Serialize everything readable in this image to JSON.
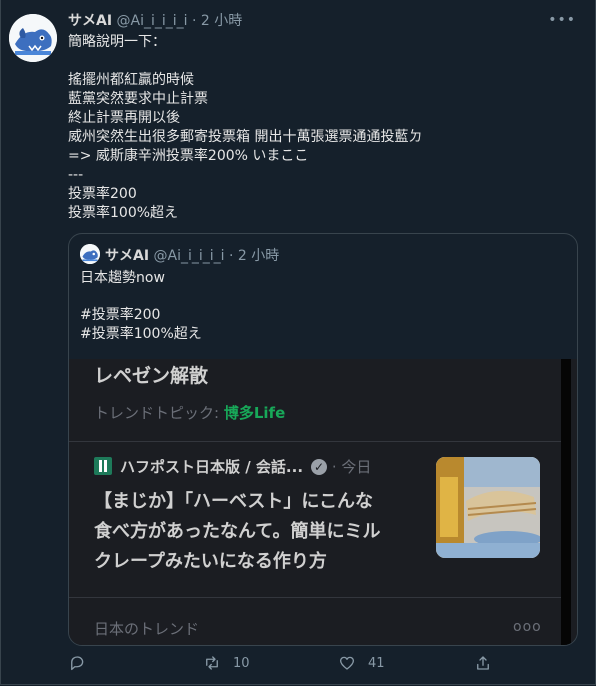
{
  "tweet": {
    "name": "サメAI",
    "handle": "@Ai_i_i_i_i",
    "dot": "·",
    "time": "2 小時",
    "more": "•••",
    "lines": [
      "簡略說明一下：",
      "",
      "搖擺州都紅贏的時候",
      "藍黨突然要求中止計票",
      "終止計票再開以後",
      "威州突然生出很多郵寄投票箱 開出十萬張選票通通投藍ㄉ",
      " => 威斯康辛洲投票率200% いまここ",
      "---",
      "投票率200",
      "投票率100%超え"
    ]
  },
  "quote": {
    "name": "サメAI",
    "handle": "@Ai_i_i_i_i",
    "dot": "·",
    "time": "2 小時",
    "lines": [
      "日本趨勢now",
      "",
      "#投票率200",
      "#投票率100%超え"
    ],
    "media": {
      "title": "レペゼン解散",
      "trend_label": "トレンドトピック:",
      "trend_tag": "博多Life",
      "publisher": "ハフポスト日本版 / 会話...",
      "pub_dot": "·",
      "pub_time": "今日",
      "headline": [
        "【まじか】「ハーベスト」にこんな",
        "食べ方があったなんて。簡単にミル",
        "クレープみたいになる作り方"
      ],
      "jp_trend": "日本のトレンド",
      "more": "ooo"
    }
  },
  "actions": {
    "reply_count": "",
    "retweet_count": "10",
    "like_count": "41"
  }
}
